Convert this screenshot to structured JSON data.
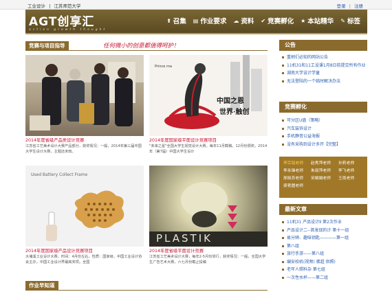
{
  "topbar": {
    "site_a": "工业设计",
    "sep": "|",
    "site_b": "江苏师范大学",
    "login": "登录",
    "register": "注册"
  },
  "header": {
    "logo_main": "AGT创享汇",
    "logo_sub": "action  growth  thought",
    "nav": [
      {
        "icon": "upload-icon",
        "glyph": "⬆",
        "label": "召集"
      },
      {
        "icon": "document-icon",
        "glyph": "▤",
        "label": "作业要求"
      },
      {
        "icon": "cloud-icon",
        "glyph": "☁",
        "label": "资料"
      },
      {
        "icon": "check-icon",
        "glyph": "✔",
        "label": "竞赛孵化"
      },
      {
        "icon": "star-icon",
        "glyph": "★",
        "label": "本站精华"
      },
      {
        "icon": "tag-icon",
        "glyph": "✎",
        "label": "标签"
      }
    ]
  },
  "main": {
    "section_title": "竞赛与项目指导",
    "slogan": "任何微小的创意都值得呵护！",
    "cards": [
      {
        "title": "2014年度省级产品类设计竞赛",
        "desc": "江苏省工艺美术设计大赛产品部分，获奖情况：一般，2014年第三届中国大学生设计大赛，主题还未知。"
      },
      {
        "title": "2014年度国家级平面设计竞赛项目",
        "desc": "\"未来之星\"全国大学生视觉设计大赛，每年11月截稿，12月份颁奖。2014年（第7届）中国大学生设计"
      },
      {
        "title": "2014年度国家级产品设计竞赛项目",
        "desc": "大埔溪工业设计大赛，时间：4月份左右，性质：国家级，中国工业设计协会主办，中国工业设计界最高奖项。全国"
      },
      {
        "title": "2014年度省级平面设计竞赛",
        "desc": "江苏省工艺美术设计大赛，每年2-5月份举行，获奖情况：一般，全国大学生广告艺术大赛，六七月份截止投稿"
      }
    ],
    "card_images": {
      "poster_text_a": "中国之恩",
      "poster_text_b": "世界·触创",
      "poster_caption": "Prince    ma",
      "battery_title": "Used Battery Collect Frame",
      "plastik": "PLASTIK"
    },
    "bottom_section_title": "作业早知道"
  },
  "sidebar": {
    "notice": {
      "title": "公告",
      "items": [
        {
          "text": "重刷们必知的网站公告",
          "red": false
        },
        {
          "text": "11机31和11工设课1月8日前提交所有作业",
          "red": false
        },
        {
          "text": "湖南大学设计学童",
          "red": false
        },
        {
          "text": "无法登陆的一个临时解决办法",
          "red": false
        }
      ]
    },
    "incubation": {
      "title": "竞赛孵化",
      "items": [
        {
          "text": "可分区U盘（策略）",
          "red": false
        },
        {
          "text": "汽车装饰设计",
          "red": false
        },
        {
          "text": "手机静音公益海报",
          "red": false
        },
        {
          "text": "没有采购到设计多开【完整】",
          "red": false
        }
      ]
    },
    "teachers": [
      {
        "name": "李宗铭老师",
        "hl": true
      },
      {
        "name": "赵秀萍老师",
        "hl": false
      },
      {
        "name": "孙莉老师",
        "hl": false
      },
      {
        "name": "李永锋老师",
        "hl": false
      },
      {
        "name": "朱丽萍老师",
        "hl": false
      },
      {
        "name": "李飞老师",
        "hl": false
      },
      {
        "name": "邢晓芳老师",
        "hl": false
      },
      {
        "name": "宋娟娟老师",
        "hl": false
      },
      {
        "name": "王雨老师",
        "hl": false
      },
      {
        "name": "梁艳圆老师",
        "hl": false
      }
    ],
    "latest": {
      "title": "最新文章",
      "items": [
        {
          "text": "11机31 产品设计Ⅱ 第2次作业",
          "red": false
        },
        {
          "text": "产品设计二--首发现的计 第十一组",
          "red": false
        },
        {
          "text": "易分辨、趣味钥匙————第一组",
          "red": false
        },
        {
          "text": "第八组",
          "red": false
        },
        {
          "text": "旅行手游——第八组",
          "red": false
        },
        {
          "text": "编安校机(视频) 蛋超 供照)",
          "red": false
        },
        {
          "text": "老年人照料杂 第七组",
          "red": false
        },
        {
          "text": "一次性水杯——第二组",
          "red": false
        }
      ]
    }
  },
  "colors": {
    "brand_brown": "#8a6a2d",
    "accent_red": "#c8102e",
    "link_blue": "#2a5db0"
  }
}
